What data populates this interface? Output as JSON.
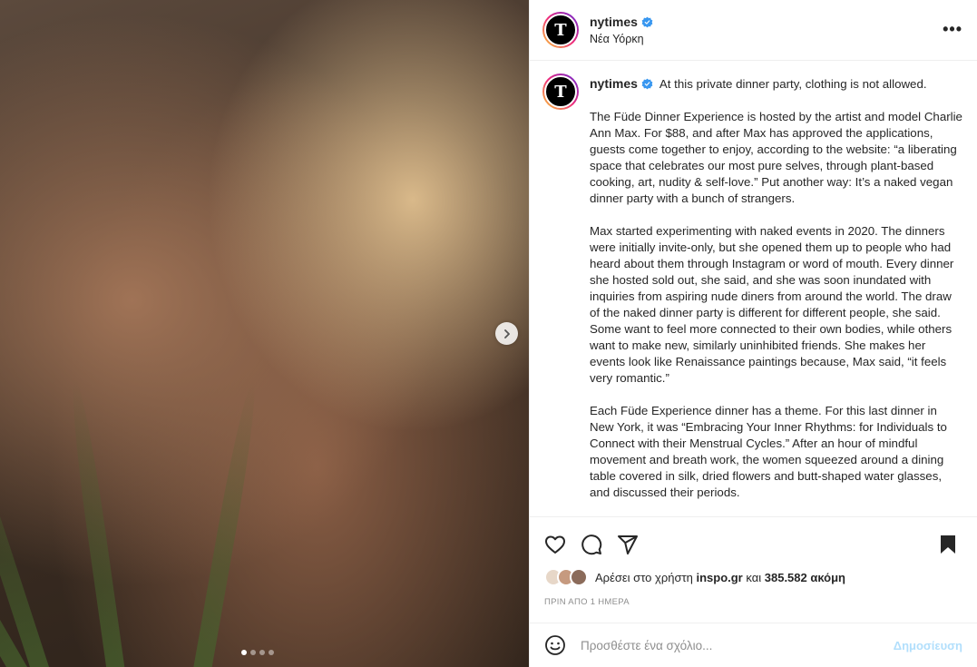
{
  "post": {
    "username": "nytimes",
    "location": "Νέα Υόρκη",
    "avatar_letter": "T",
    "more_label": "•••"
  },
  "media": {
    "dots_total": 4,
    "dots_active_index": 0
  },
  "caption": {
    "username": "nytimes",
    "first_line": "At this private dinner party, clothing is not allowed.",
    "paragraphs": [
      "The Füde Dinner Experience is hosted by the artist and model Charlie Ann Max. For $88, and after Max has approved the applications, guests come together to enjoy, according to the website: “a liberating space that celebrates our most pure selves, through plant-based cooking, art, nudity & self-love.” Put another way: It’s a naked vegan dinner party with a bunch of strangers.",
      "Max started experimenting with naked events in 2020. The dinners were initially invite-only, but she opened them up to people who had heard about them through Instagram or word of mouth. Every dinner she hosted sold out, she said, and she was soon inundated with inquiries from aspiring nude diners from around the world. The draw of the naked dinner party is different for different people, she said. Some want to feel more connected to their own bodies, while others want to make new, similarly uninhibited friends. She makes her events look like Renaissance paintings because, Max said, “it feels very romantic.”",
      "Each Füde Experience dinner has a theme. For this last dinner in New York, it was “Embracing Your Inner Rhythms: for Individuals to Connect with their Menstrual Cycles.” After an hour of mindful movement and breath work, the women squeezed around a dining table covered in silk, dried flowers and butt-shaped water glasses, and discussed their periods."
    ]
  },
  "likes": {
    "prefix": "Αρέσει στο χρήστη",
    "user": "inspo.gr",
    "connector": "και",
    "count": "385.582 ακόμη"
  },
  "timestamp": "ΠΡΙΝ ΑΠΟ 1 ΗΜΕΡΑ",
  "comment": {
    "placeholder": "Προσθέστε ένα σχόλιο...",
    "post_label": "Δημοσίευση"
  },
  "colors": {
    "verified": "#3897f0",
    "post_disabled": "#b2dffc",
    "muted": "#8e8e8e"
  }
}
